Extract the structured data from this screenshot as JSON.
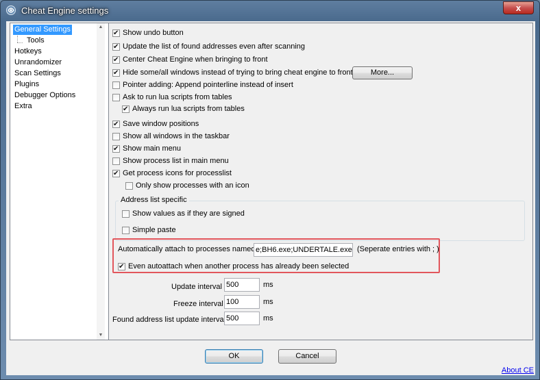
{
  "window": {
    "title": "Cheat Engine settings",
    "close_label": "x"
  },
  "sidebar": {
    "items": [
      {
        "label": "General Settings"
      },
      {
        "label": "Tools"
      },
      {
        "label": "Hotkeys"
      },
      {
        "label": "Unrandomizer"
      },
      {
        "label": "Scan Settings"
      },
      {
        "label": "Plugins"
      },
      {
        "label": "Debugger Options"
      },
      {
        "label": "Extra"
      }
    ],
    "selected": "General Settings"
  },
  "general": {
    "show_undo": {
      "label": "Show undo button",
      "checked": true
    },
    "update_found_list": {
      "label": "Update the list of found addresses even after scanning",
      "checked": true
    },
    "center_ce": {
      "label": "Center Cheat Engine when bringing to front",
      "checked": true
    },
    "hide_windows": {
      "label": "Hide some/all windows instead of trying to bring cheat engine to front",
      "checked": true
    },
    "more_button": "More...",
    "pointer_adding": {
      "label": "Pointer adding: Append pointerline instead of insert",
      "checked": false
    },
    "ask_lua": {
      "label": "Ask to run lua scripts from tables",
      "checked": false
    },
    "always_lua": {
      "label": "Always run lua scripts from tables",
      "checked": true
    },
    "save_window_positions": {
      "label": "Save window positions",
      "checked": true
    },
    "show_all_taskbar": {
      "label": "Show all windows in the taskbar",
      "checked": false
    },
    "show_main_menu": {
      "label": "Show main menu",
      "checked": true
    },
    "show_process_list": {
      "label": "Show process list in main menu",
      "checked": false
    },
    "get_process_icons": {
      "label": "Get process icons for processlist",
      "checked": true
    },
    "only_with_icon": {
      "label": "Only show processes with an icon",
      "checked": false
    }
  },
  "address_list": {
    "group_label": "Address list specific",
    "show_signed": {
      "label": "Show values as if they are signed",
      "checked": false
    },
    "simple_paste": {
      "label": "Simple paste",
      "checked": false
    }
  },
  "autoattach": {
    "label": "Automatically attach to processes named",
    "value": "e;BH6.exe;UNDERTALE.exe",
    "hint": "(Seperate entries with ; )",
    "even_autoattach": {
      "label": "Even autoattach when another process has already been selected",
      "checked": true
    }
  },
  "intervals": {
    "update": {
      "label": "Update interval",
      "value": "500",
      "unit": "ms"
    },
    "freeze": {
      "label": "Freeze interval",
      "value": "100",
      "unit": "ms"
    },
    "found_list": {
      "label": "Found address list update interval",
      "value": "500",
      "unit": "ms"
    }
  },
  "footer": {
    "ok": "OK",
    "cancel": "Cancel",
    "about": "About CE"
  }
}
